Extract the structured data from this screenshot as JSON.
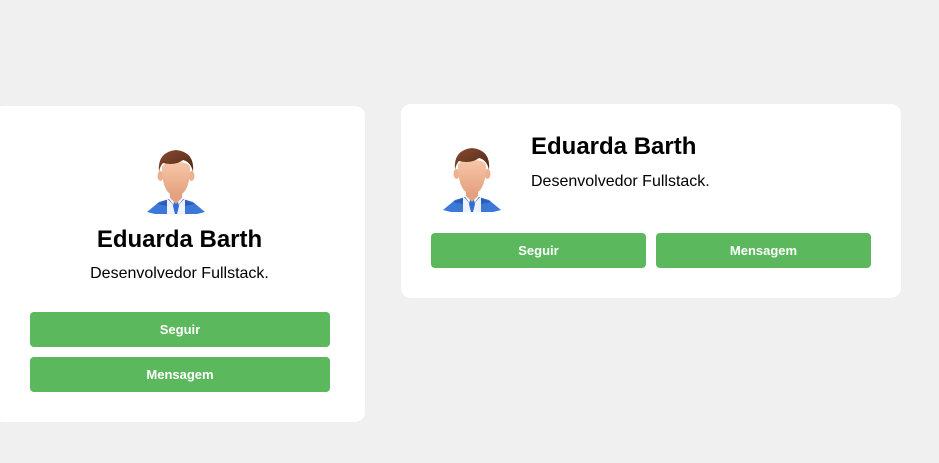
{
  "cards": [
    {
      "layout": "vertical",
      "avatar_icon": "user-avatar-icon",
      "name": "Eduarda Barth",
      "role": "Desenvolvedor Fullstack.",
      "buttons": {
        "follow": "Seguir",
        "message": "Mensagem"
      }
    },
    {
      "layout": "horizontal",
      "avatar_icon": "user-avatar-icon",
      "name": "Eduarda Barth",
      "role": "Desenvolvedor Fullstack.",
      "buttons": {
        "follow": "Seguir",
        "message": "Mensagem"
      }
    }
  ],
  "colors": {
    "page_background": "#f0f0f0",
    "card_background": "#ffffff",
    "button_background": "#5cb85c",
    "button_text": "#ffffff",
    "tie": "#2f6fd6",
    "hair": "#6b3a26",
    "skin": "#f1b99a"
  }
}
